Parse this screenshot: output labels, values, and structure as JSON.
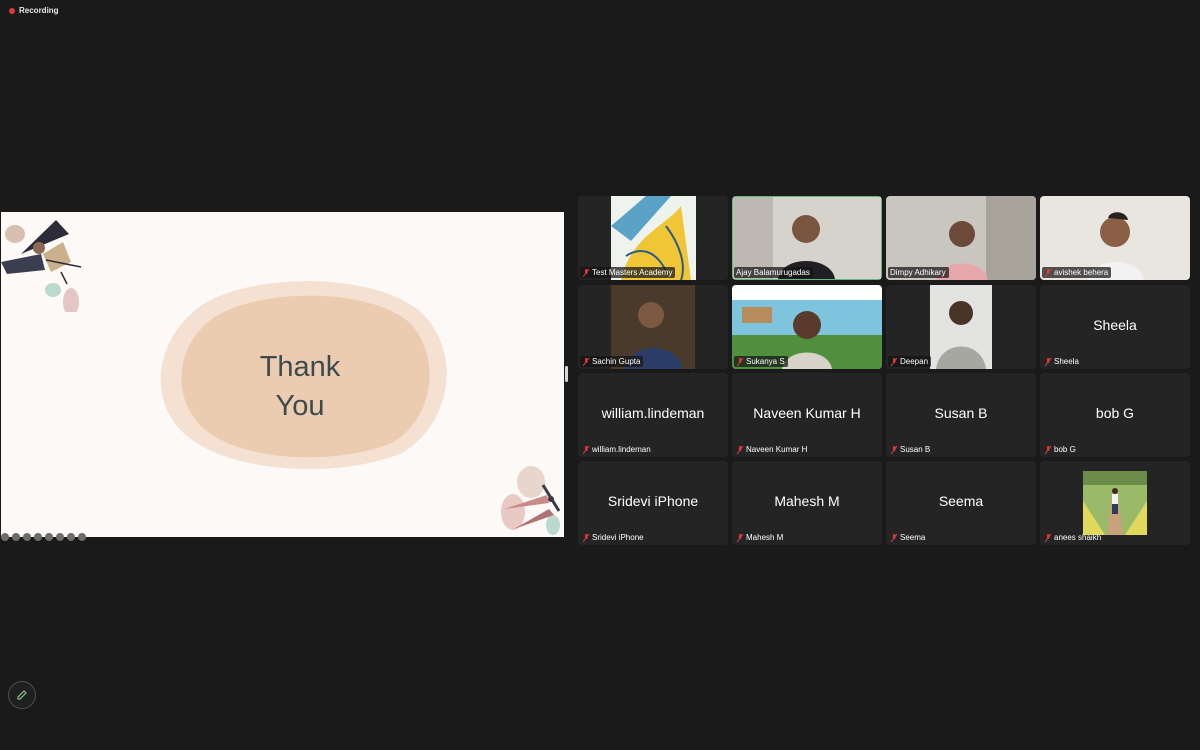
{
  "recording": {
    "label": "Recording"
  },
  "slide": {
    "line1": "Thank",
    "line2": "You"
  },
  "participants": [
    {
      "name": "Test Masters Academy",
      "video": true
    },
    {
      "name": "Ajay Balamurugadas",
      "video": true,
      "active_speaker": true
    },
    {
      "name": "Dimpy Adhikary",
      "video": true
    },
    {
      "name": "avishek behera",
      "video": true
    },
    {
      "name": "Sachin Gupta",
      "video": true
    },
    {
      "name": "Sukanya S",
      "video": true
    },
    {
      "name": "Deepan",
      "video": true
    },
    {
      "name": "Sheela",
      "video": false
    },
    {
      "name": "william.lindeman",
      "video": false
    },
    {
      "name": "Naveen Kumar H",
      "video": false
    },
    {
      "name": "Susan B",
      "video": false
    },
    {
      "name": "bob G",
      "video": false
    },
    {
      "name": "Sridevi iPhone",
      "video": false
    },
    {
      "name": "Mahesh M",
      "video": false
    },
    {
      "name": "Seema",
      "video": false
    },
    {
      "name": "anees shaikh",
      "video": true
    }
  ],
  "colors": {
    "active_speaker": "#69b67a",
    "muted_icon": "#e0383e",
    "recording_dot": "#e0383e"
  },
  "icons": {
    "recording": "recording-dot-icon",
    "muted": "muted-mic-icon",
    "annotate": "pencil-icon"
  }
}
